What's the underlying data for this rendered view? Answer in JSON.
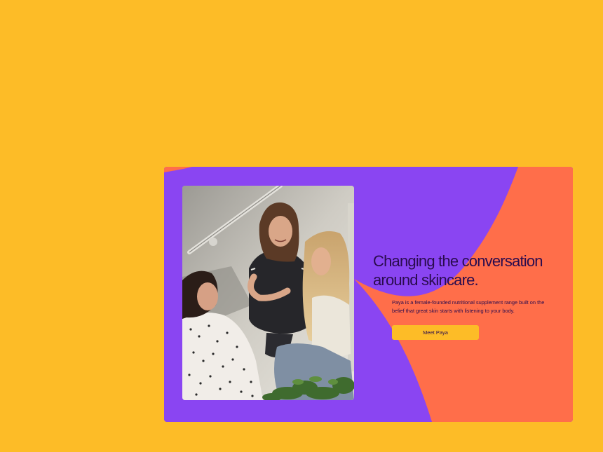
{
  "page": {
    "background_color": "#FDBC27"
  },
  "hero": {
    "card_color": "#8A45F2",
    "accent_shape_color": "#FF6E4A",
    "headline": "Changing the conversation around skincare.",
    "description": "Paya is a female-founded nutritional supplement range built on the belief that great skin starts with listening to your body.",
    "cta_label": "Meet Paya",
    "cta_color": "#FDBC27",
    "text_color": "#2A0C4E"
  },
  "image": {
    "subject": "photo-three-women-sitting-on-steps"
  }
}
